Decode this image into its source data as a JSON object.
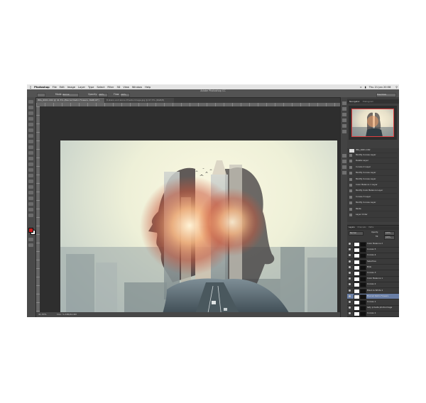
{
  "menubar": {
    "apple": "",
    "items": [
      "Photoshop",
      "File",
      "Edit",
      "Image",
      "Layer",
      "Type",
      "Select",
      "Filter",
      "3D",
      "View",
      "Window",
      "Help"
    ],
    "clock": "Thu 21 Jan  20:58"
  },
  "options": {
    "app_title": "Adobe Photoshop CC",
    "mode_label": "Mode:",
    "mode_value": "Normal",
    "opacity_label": "Opacity:",
    "opacity_value": "100%",
    "flow_label": "Flow:",
    "flow_value": "100%",
    "workspace": "Essentials"
  },
  "document": {
    "tab_active": "IMG_6001.CR2 @ 41.5% (Blurred Retro Flowers, RGB/16*)",
    "tab_inactive": "8 stairs and alone Private Image.jpg @ 67.5% (RGB/8)",
    "zoom": "41.53%",
    "doc_info": "Doc: 5.24M/44.9M"
  },
  "panels": {
    "navigator_tab": "Navigator",
    "histogram_tab": "Histogram",
    "history_snapshot": "IMG_6001.CR2",
    "history": [
      "Modify Curves Layer",
      "Delete Layer",
      "Curves 2 Layer",
      "Modify Curves Layer",
      "Modify Curves Layer",
      "Color Balance 1 Layer",
      "Modify Color Balance Layer",
      "Curves 3 Layer",
      "Modify Curves Layer",
      "Paste",
      "Layer Order"
    ],
    "layers_tabs": [
      "Layers",
      "Channels",
      "Paths"
    ],
    "blend_mode": "Normal",
    "opacity_label": "Opacity:",
    "opacity_value": "100%",
    "fill_label": "Fill:",
    "fill_value": "100%",
    "layers": [
      {
        "name": "Color Balance 2"
      },
      {
        "name": "Curves 5"
      },
      {
        "name": "Curves 4"
      },
      {
        "name": "Selective"
      },
      {
        "name": "Blob"
      },
      {
        "name": "Curves 3"
      },
      {
        "name": "Color Balance 1"
      },
      {
        "name": "Curves 2"
      },
      {
        "name": "Black & White 1"
      },
      {
        "name": "Blurred Retro Flowers"
      },
      {
        "name": "Curves 1"
      },
      {
        "name": "lady private photo.image"
      },
      {
        "name": "Curves 1"
      }
    ],
    "selected_layer": "Blurred Retro Flowers"
  },
  "colors": {
    "foreground": "#c81e1e",
    "background": "#ffffff",
    "selection": "#6a7fa6"
  }
}
